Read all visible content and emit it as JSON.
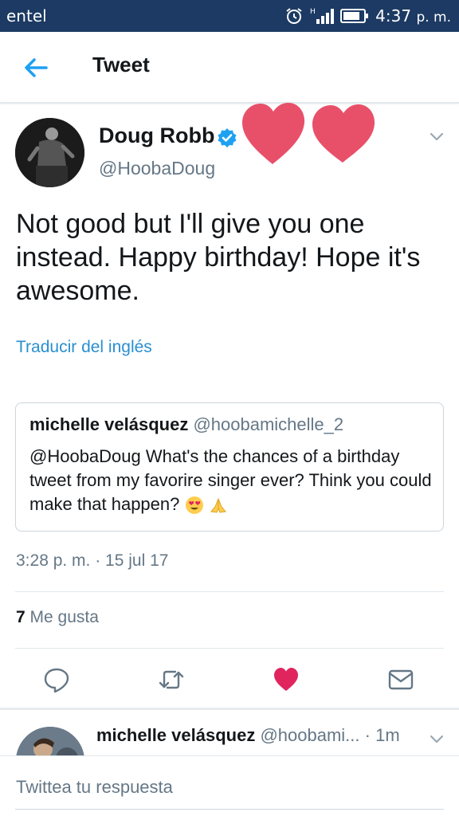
{
  "status_bar": {
    "carrier": "entel",
    "time": "4:37",
    "ampm": "p. m.",
    "network": "H"
  },
  "app_bar": {
    "title": "Tweet"
  },
  "tweet": {
    "author_name": "Doug Robb",
    "author_handle": "@HoobaDoug",
    "text": "Not good but I'll give you one instead. Happy birthday! Hope it's awesome.",
    "translate_label": "Traducir del inglés",
    "timestamp": "3:28 p. m. · 15 jul 17",
    "likes_count": "7",
    "likes_label": "Me gusta",
    "liked": true
  },
  "quoted_tweet": {
    "author_name": "michelle velásquez",
    "author_handle": "@hoobamichelle_2",
    "text": "@HoobaDoug What's the chances of a birthday tweet from my favorire singer ever? Think you could make that happen?"
  },
  "reply_preview": {
    "author_name": "michelle velásquez",
    "author_handle": "@hoobami...",
    "age": "· 1m"
  },
  "compose": {
    "placeholder": "Twittea tu respuesta"
  },
  "colors": {
    "status_bar": "#1c3a63",
    "accent": "#1da1f2",
    "like": "#e0245e",
    "hearts_sticker": "#e8506a",
    "text_secondary": "#657786"
  },
  "icons": {
    "back": "arrow-left-icon",
    "verified": "verified-badge-icon",
    "chevron": "chevron-down-icon",
    "reply": "reply-icon",
    "retweet": "retweet-icon",
    "like": "heart-icon",
    "message": "envelope-icon"
  }
}
